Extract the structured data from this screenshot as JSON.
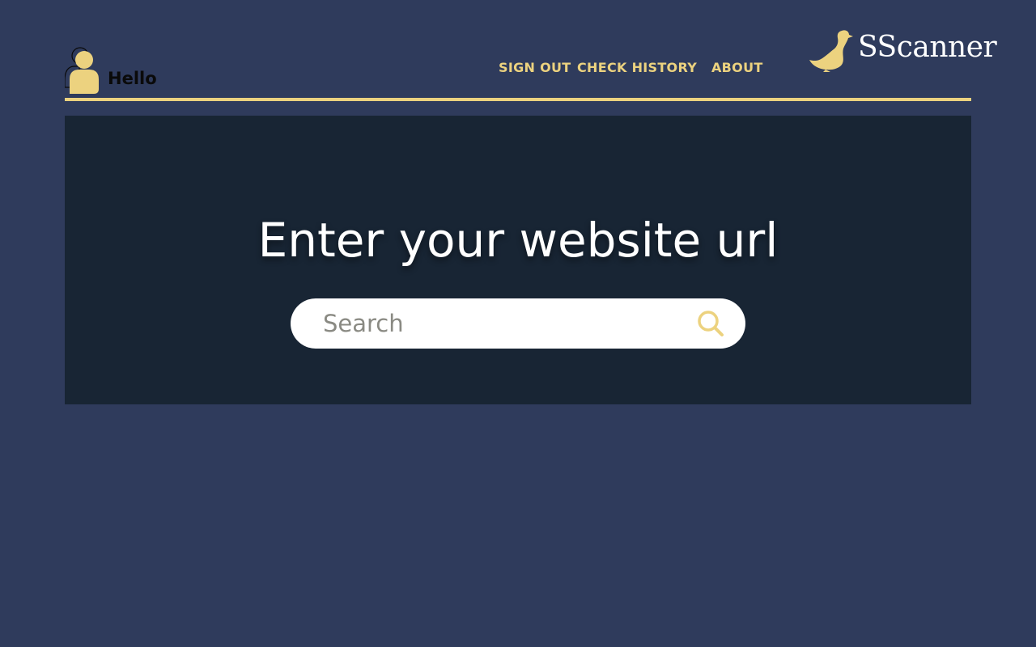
{
  "user": {
    "greeting": "Hello",
    "avatar_icon": "user-silhouette-icon"
  },
  "nav": {
    "items": [
      {
        "label": "SIGN OUT"
      },
      {
        "label": "CHECK HISTORY"
      },
      {
        "label": "ABOUT"
      }
    ]
  },
  "brand": {
    "name": "SScanner",
    "logo_icon": "duck-icon"
  },
  "hero": {
    "title": "Enter your website url"
  },
  "search": {
    "placeholder": "Search",
    "value": "",
    "button_icon": "search-icon"
  },
  "colors": {
    "page_background": "#2f3b5c",
    "hero_background": "#182534",
    "accent": "#ecd27f",
    "text_light": "#ffffff",
    "text_dark": "#0a0a0a"
  }
}
